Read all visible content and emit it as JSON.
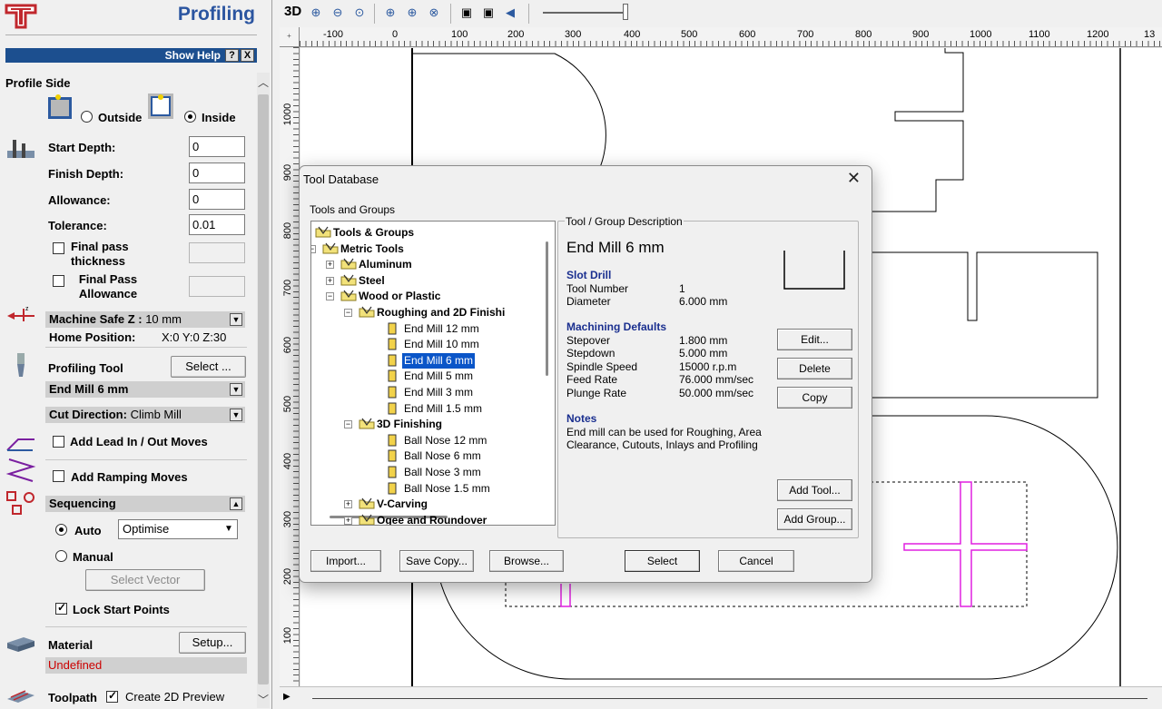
{
  "left_panel": {
    "title": "Profiling",
    "show_help": "Show Help",
    "help_q": "?",
    "help_x": "X",
    "profile_side": {
      "heading": "Profile Side",
      "outside_label": "Outside",
      "inside_label": "Inside",
      "selected": "inside"
    },
    "depths": {
      "start_depth_label": "Start Depth:",
      "start_depth_value": "0",
      "finish_depth_label": "Finish Depth:",
      "finish_depth_value": "0",
      "allowance_label": "Allowance:",
      "allowance_value": "0",
      "tolerance_label": "Tolerance:",
      "tolerance_value": "0.01",
      "final_pass_thickness_label": "Final pass thickness",
      "final_pass_allowance_label": "Final Pass Allowance"
    },
    "machine": {
      "safe_z_label": "Machine Safe Z :",
      "safe_z_value": "10 mm",
      "home_label": "Home Position:",
      "home_value": "X:0 Y:0 Z:30"
    },
    "tool": {
      "label": "Profiling Tool",
      "select_button": "Select ...",
      "name": "End Mill 6 mm"
    },
    "cut_direction": {
      "label": "Cut Direction:",
      "value": "Climb Mill"
    },
    "lead_label": "Add Lead In / Out Moves",
    "ramp_label": "Add Ramping Moves",
    "sequencing": {
      "heading": "Sequencing",
      "auto_label": "Auto",
      "manual_label": "Manual",
      "combo_value": "Optimise",
      "select_vector": "Select Vector",
      "lock_start_label": "Lock Start Points"
    },
    "material": {
      "label": "Material",
      "setup_button": "Setup...",
      "status": "Undefined"
    },
    "toolpath": {
      "label": "Toolpath",
      "preview_label": "Create 2D Preview"
    }
  },
  "toolbar": {
    "mode_3d": "3D"
  },
  "ruler": {
    "top_ticks": [
      "-100",
      "0",
      "100",
      "200",
      "300",
      "400",
      "500",
      "600",
      "700",
      "800",
      "900",
      "1000",
      "1100",
      "1200",
      "13"
    ],
    "left_ticks": [
      "1000",
      "900",
      "800",
      "700",
      "600",
      "500",
      "400",
      "300",
      "200",
      "100"
    ]
  },
  "dialog": {
    "title": "Tool Database",
    "tree_group_label": "Tools and Groups",
    "desc_group_label": "Tool / Group Description",
    "tree": [
      {
        "label": "Tools & Groups",
        "level": 0,
        "kind": "folder",
        "bold": true,
        "expander": ""
      },
      {
        "label": "Metric Tools",
        "level": 1,
        "kind": "folder",
        "bold": true,
        "expander": "-"
      },
      {
        "label": "Aluminum",
        "level": 2,
        "kind": "folder",
        "bold": true,
        "expander": "+"
      },
      {
        "label": "Steel",
        "level": 2,
        "kind": "folder",
        "bold": true,
        "expander": "+"
      },
      {
        "label": "Wood or Plastic",
        "level": 2,
        "kind": "folder",
        "bold": true,
        "expander": "-"
      },
      {
        "label": "Roughing and 2D Finishi",
        "level": 3,
        "kind": "folder",
        "bold": true,
        "expander": "-"
      },
      {
        "label": "End Mill 12 mm",
        "level": 4,
        "kind": "tool",
        "bold": false,
        "expander": ""
      },
      {
        "label": "End Mill 10 mm",
        "level": 4,
        "kind": "tool",
        "bold": false,
        "expander": ""
      },
      {
        "label": "End Mill 6 mm",
        "level": 4,
        "kind": "tool",
        "bold": false,
        "expander": "",
        "selected": true
      },
      {
        "label": "End Mill 5 mm",
        "level": 4,
        "kind": "tool",
        "bold": false,
        "expander": ""
      },
      {
        "label": "End Mill 3 mm",
        "level": 4,
        "kind": "tool",
        "bold": false,
        "expander": ""
      },
      {
        "label": "End Mill 1.5 mm",
        "level": 4,
        "kind": "tool",
        "bold": false,
        "expander": ""
      },
      {
        "label": "3D Finishing",
        "level": 3,
        "kind": "folder",
        "bold": true,
        "expander": "-"
      },
      {
        "label": "Ball Nose 12 mm",
        "level": 4,
        "kind": "tool",
        "bold": false,
        "expander": ""
      },
      {
        "label": "Ball Nose 6 mm",
        "level": 4,
        "kind": "tool",
        "bold": false,
        "expander": ""
      },
      {
        "label": "Ball Nose 3 mm",
        "level": 4,
        "kind": "tool",
        "bold": false,
        "expander": ""
      },
      {
        "label": "Ball Nose 1.5 mm",
        "level": 4,
        "kind": "tool",
        "bold": false,
        "expander": ""
      },
      {
        "label": "V-Carving",
        "level": 3,
        "kind": "folder",
        "bold": true,
        "expander": "+"
      },
      {
        "label": "Ogee and Roundover",
        "level": 3,
        "kind": "folder",
        "bold": true,
        "expander": "+"
      }
    ],
    "desc": {
      "tool_name": "End Mill 6 mm",
      "type_heading": "Slot Drill",
      "tool_number_label": "Tool Number",
      "tool_number_value": "1",
      "diameter_label": "Diameter",
      "diameter_value": "6.000 mm",
      "defaults_heading": "Machining Defaults",
      "stepover_label": "Stepover",
      "stepover_value": "1.800 mm",
      "stepdown_label": "Stepdown",
      "stepdown_value": "5.000 mm",
      "spindle_label": "Spindle Speed",
      "spindle_value": "15000 r.p.m",
      "feed_label": "Feed Rate",
      "feed_value": "76.000 mm/sec",
      "plunge_label": "Plunge Rate",
      "plunge_value": "50.000 mm/sec",
      "notes_heading": "Notes",
      "notes_line1": "End mill can be used for Roughing, Area",
      "notes_line2": "Clearance, Cutouts, Inlays and Profiling"
    },
    "buttons": {
      "edit": "Edit...",
      "delete": "Delete",
      "copy": "Copy",
      "add_tool": "Add Tool...",
      "add_group": "Add Group...",
      "import": "Import...",
      "save_copy": "Save Copy...",
      "browse": "Browse...",
      "select": "Select",
      "cancel": "Cancel"
    }
  },
  "colors": {
    "help_bar": "#1c4f8f",
    "title_blue": "#2b55a0",
    "selection": "#0a55c8",
    "toolpath_magenta": "#e020e0",
    "undefined_red": "#cc0000",
    "heading_navy": "#1a2f8f"
  }
}
